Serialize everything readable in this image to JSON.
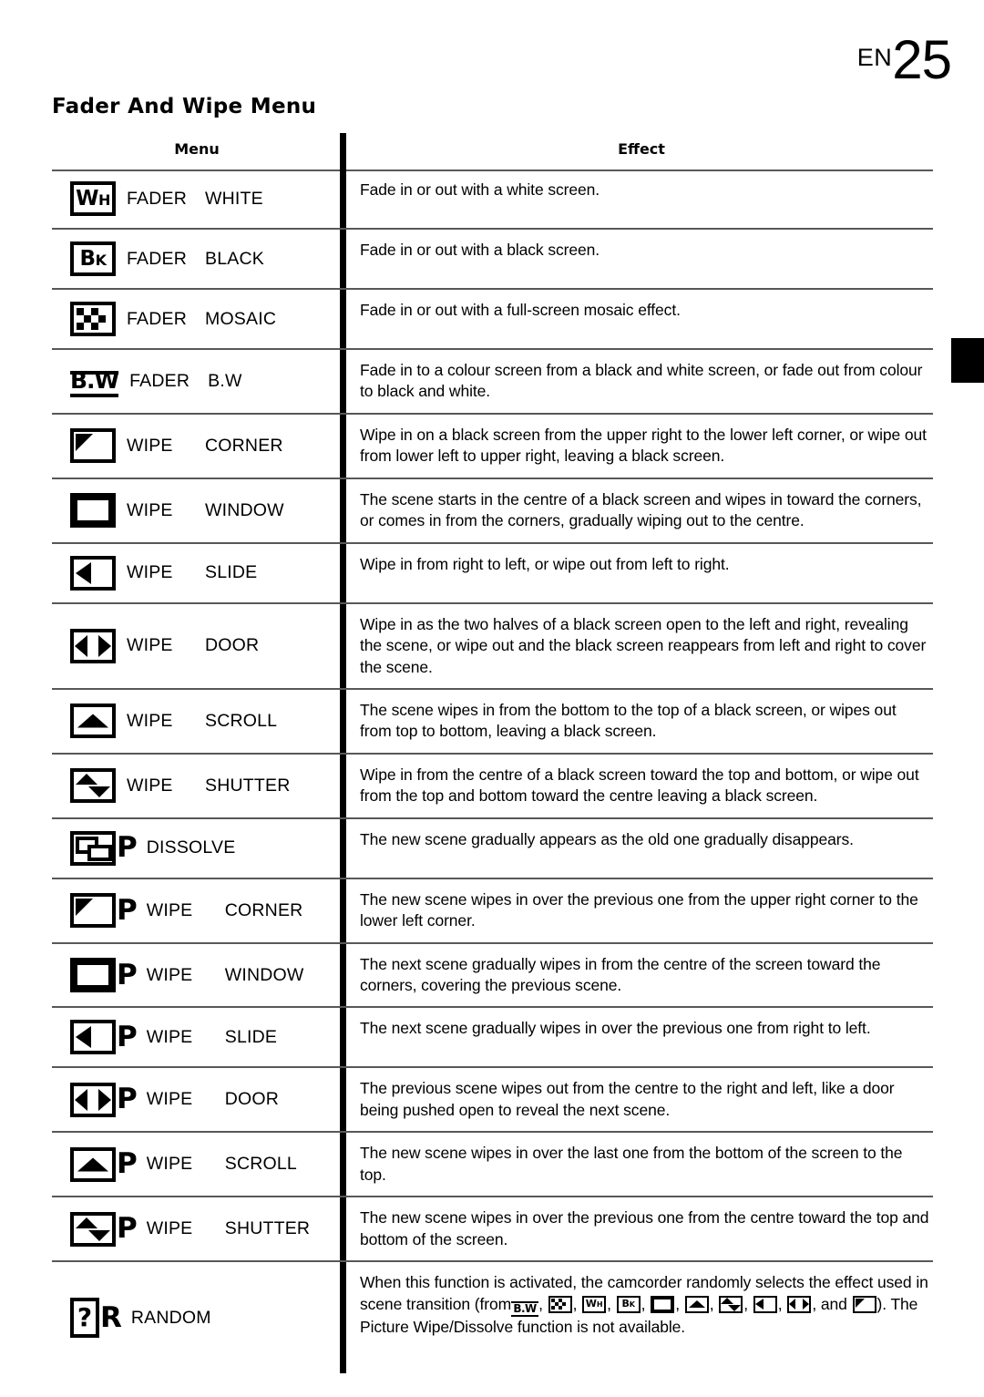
{
  "page": {
    "edition_label": "EN",
    "page_number": "25",
    "section_title": "Fader And Wipe Menu"
  },
  "table": {
    "headers": {
      "menu": "Menu",
      "effect": "Effect"
    },
    "rows": [
      {
        "icon": "fader-white-icon",
        "icon_text": "WH",
        "name1": "FADER",
        "name2": "WHITE",
        "effect": "Fade in or out with a white screen."
      },
      {
        "icon": "fader-black-icon",
        "icon_text": "BK",
        "name1": "FADER",
        "name2": "BLACK",
        "effect": "Fade in or out with a black screen."
      },
      {
        "icon": "fader-mosaic-icon",
        "icon_text": "",
        "name1": "FADER",
        "name2": "MOSAIC",
        "effect": "Fade in or out with a full-screen mosaic effect."
      },
      {
        "icon": "fader-bw-icon",
        "icon_text": "B.W",
        "name1": "FADER",
        "name2": "B.W",
        "effect": "Fade in to a colour screen from a black and white screen, or fade out from colour to black and white."
      },
      {
        "icon": "wipe-corner-icon",
        "icon_text": "",
        "name1": "WIPE",
        "name2": "CORNER",
        "effect": "Wipe in on a black screen from the upper right to the lower left corner, or wipe out from lower left to upper right, leaving a black screen."
      },
      {
        "icon": "wipe-window-icon",
        "icon_text": "",
        "name1": "WIPE",
        "name2": "WINDOW",
        "effect": "The scene starts in the centre of a black screen and wipes in toward the corners, or comes in from the corners, gradually wiping out to the centre."
      },
      {
        "icon": "wipe-slide-icon",
        "icon_text": "",
        "name1": "WIPE",
        "name2": "SLIDE",
        "effect": "Wipe in from right to left, or wipe out from left to right."
      },
      {
        "icon": "wipe-door-icon",
        "icon_text": "",
        "name1": "WIPE",
        "name2": "DOOR",
        "effect": "Wipe in as the two halves of a black screen open to the left and right, revealing the scene, or wipe out and the black screen reappears from left and right to cover the scene."
      },
      {
        "icon": "wipe-scroll-icon",
        "icon_text": "",
        "name1": "WIPE",
        "name2": "SCROLL",
        "effect": "The scene wipes in from the bottom to the top of a black screen, or wipes out from top to bottom, leaving a black screen."
      },
      {
        "icon": "wipe-shutter-icon",
        "icon_text": "",
        "name1": "WIPE",
        "name2": "SHUTTER",
        "effect": "Wipe in from the centre of a black screen toward the top and bottom, or wipe out from the top and bottom toward the centre leaving a black screen."
      },
      {
        "icon": "dissolve-icon",
        "icon_suffix": "P",
        "icon_text": "",
        "name1": "DISSOLVE",
        "name2": "",
        "effect": "The new scene gradually appears as the old one gradually disappears."
      },
      {
        "icon": "picture-wipe-corner-icon",
        "icon_suffix": "P",
        "icon_text": "",
        "name1": "WIPE",
        "name2": "CORNER",
        "effect": "The new scene wipes in over the previous one from the upper right corner to the lower left corner."
      },
      {
        "icon": "picture-wipe-window-icon",
        "icon_suffix": "P",
        "icon_text": "",
        "name1": "WIPE",
        "name2": "WINDOW",
        "effect": "The next scene gradually wipes in from the centre of the screen toward the corners, covering the previous scene."
      },
      {
        "icon": "picture-wipe-slide-icon",
        "icon_suffix": "P",
        "icon_text": "",
        "name1": "WIPE",
        "name2": "SLIDE",
        "effect": "The next scene gradually wipes in over the previous one from right to left."
      },
      {
        "icon": "picture-wipe-door-icon",
        "icon_suffix": "P",
        "icon_text": "",
        "name1": "WIPE",
        "name2": "DOOR",
        "effect": "The previous scene wipes out from the centre to the right and left, like a door being pushed open to reveal the next scene."
      },
      {
        "icon": "picture-wipe-scroll-icon",
        "icon_suffix": "P",
        "icon_text": "",
        "name1": "WIPE",
        "name2": "SCROLL",
        "effect": "The new scene wipes in over the last one from the bottom of the screen to the top."
      },
      {
        "icon": "picture-wipe-shutter-icon",
        "icon_suffix": "P",
        "icon_text": "",
        "name1": "WIPE",
        "name2": "SHUTTER",
        "effect": "The new scene wipes in over the previous one from the centre toward the top and bottom of the screen."
      },
      {
        "icon": "random-icon",
        "icon_suffix": "R",
        "icon_text": "?",
        "name1": "RANDOM",
        "name2": "",
        "effect": ""
      }
    ],
    "random_effect": {
      "part1": "When this function is activated, the camcorder randomly selects the effect used in scene transition (from",
      "sep": ",",
      "and_word": ", and",
      "part2": "). The Picture Wipe/Dissolve function is not available.",
      "inline_icons": [
        "fader-bw-icon",
        "fader-mosaic-icon",
        "fader-white-icon",
        "fader-black-icon",
        "wipe-window-icon",
        "wipe-scroll-icon",
        "wipe-shutter-icon",
        "wipe-slide-icon",
        "wipe-door-icon",
        "wipe-corner-icon"
      ],
      "inline_icon_texts": [
        "B.W",
        "",
        "WH",
        "BK",
        "",
        "",
        "",
        "",
        "",
        ""
      ]
    }
  }
}
